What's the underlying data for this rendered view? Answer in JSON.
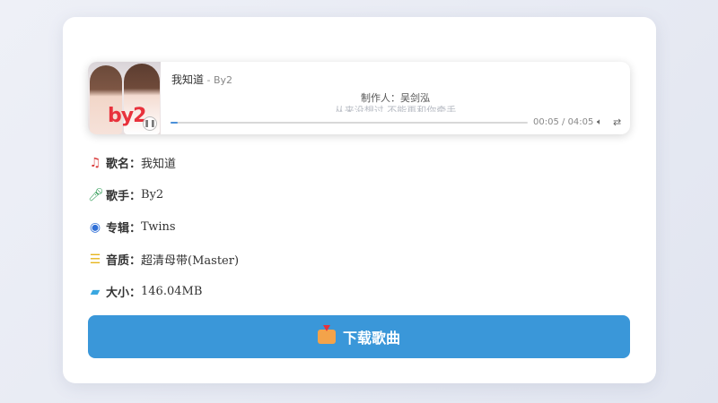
{
  "player": {
    "song_title": "我知道",
    "artist_sep": " - ",
    "artist": "By2",
    "lyric_current": "制作人：吴剑泓",
    "lyric_next": "从来没想过 不能再和你牵手",
    "time_current": "00:05",
    "time_sep": " / ",
    "time_total": "04:05",
    "progress_fraction": 0.02,
    "cover_logo": "by2",
    "icons": {
      "pause": "pause-icon",
      "volume": "volume-icon",
      "loop": "loop-icon"
    }
  },
  "info": [
    {
      "icon": "music-note-icon",
      "label": "歌名：",
      "value": "我知道",
      "color": "#d83a3a"
    },
    {
      "icon": "microphone-icon",
      "label": "歌手：",
      "value": "By2",
      "color": "#2e9b55"
    },
    {
      "icon": "disc-icon",
      "label": "专辑：",
      "value": "Twins",
      "color": "#2f6fd6"
    },
    {
      "icon": "sliders-icon",
      "label": "音质：",
      "value": "超清母带(Master)",
      "color": "#e6b51c"
    },
    {
      "icon": "folder-icon",
      "label": "大小：",
      "value": "146.04MB",
      "color": "#3aa7e0"
    }
  ],
  "download": {
    "label": "下载歌曲",
    "icon": "download-tray-icon"
  },
  "colors": {
    "accent": "#3a97d9",
    "progress": "#4a90d9"
  }
}
